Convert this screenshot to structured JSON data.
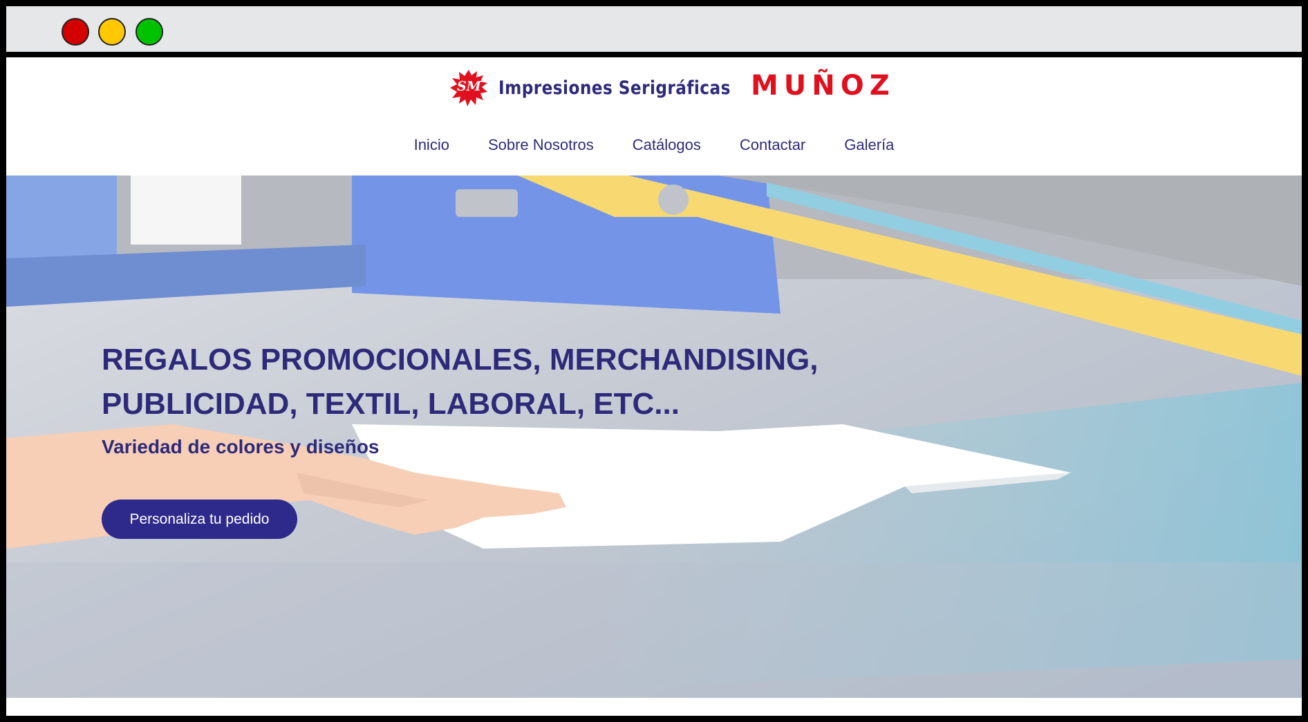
{
  "window": {
    "controls": [
      "close",
      "minimize",
      "maximize"
    ]
  },
  "header": {
    "logo_icon": "paint-splash-logo-icon",
    "logo_mark_text": "SM",
    "logo_text": "Impresiones Serigráficas",
    "brand": "MUÑOZ"
  },
  "nav": {
    "items": [
      {
        "label": "Inicio"
      },
      {
        "label": "Sobre Nosotros"
      },
      {
        "label": "Catálogos"
      },
      {
        "label": "Contactar"
      },
      {
        "label": "Galería"
      }
    ]
  },
  "hero": {
    "headline_line1": "REGALOS PROMOCIONALES, MERCHANDISING,",
    "headline_line2": "PUBLICIDAD, TEXTIL, LABORAL, ETC...",
    "subheadline": "Variedad de colores y diseños",
    "cta_label": "Personaliza tu pedido"
  },
  "colors": {
    "brand_blue": "#2e2a7a",
    "brand_red": "#e0101e",
    "button": "#2e2a8c",
    "titlebar": "#e6e7e9"
  }
}
